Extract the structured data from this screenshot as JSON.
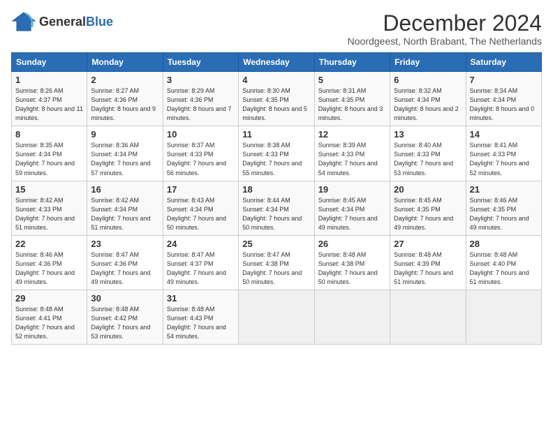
{
  "header": {
    "logo_general": "General",
    "logo_blue": "Blue",
    "title": "December 2024",
    "subtitle": "Noordgeest, North Brabant, The Netherlands"
  },
  "calendar": {
    "days_of_week": [
      "Sunday",
      "Monday",
      "Tuesday",
      "Wednesday",
      "Thursday",
      "Friday",
      "Saturday"
    ],
    "weeks": [
      [
        {
          "day": "1",
          "sunrise": "8:26 AM",
          "sunset": "4:37 PM",
          "daylight": "8 hours and 11 minutes."
        },
        {
          "day": "2",
          "sunrise": "8:27 AM",
          "sunset": "4:36 PM",
          "daylight": "8 hours and 9 minutes."
        },
        {
          "day": "3",
          "sunrise": "8:29 AM",
          "sunset": "4:36 PM",
          "daylight": "8 hours and 7 minutes."
        },
        {
          "day": "4",
          "sunrise": "8:30 AM",
          "sunset": "4:35 PM",
          "daylight": "8 hours and 5 minutes."
        },
        {
          "day": "5",
          "sunrise": "8:31 AM",
          "sunset": "4:35 PM",
          "daylight": "8 hours and 3 minutes."
        },
        {
          "day": "6",
          "sunrise": "8:32 AM",
          "sunset": "4:34 PM",
          "daylight": "8 hours and 2 minutes."
        },
        {
          "day": "7",
          "sunrise": "8:34 AM",
          "sunset": "4:34 PM",
          "daylight": "8 hours and 0 minutes."
        }
      ],
      [
        {
          "day": "8",
          "sunrise": "8:35 AM",
          "sunset": "4:34 PM",
          "daylight": "7 hours and 59 minutes."
        },
        {
          "day": "9",
          "sunrise": "8:36 AM",
          "sunset": "4:34 PM",
          "daylight": "7 hours and 57 minutes."
        },
        {
          "day": "10",
          "sunrise": "8:37 AM",
          "sunset": "4:33 PM",
          "daylight": "7 hours and 56 minutes."
        },
        {
          "day": "11",
          "sunrise": "8:38 AM",
          "sunset": "4:33 PM",
          "daylight": "7 hours and 55 minutes."
        },
        {
          "day": "12",
          "sunrise": "8:39 AM",
          "sunset": "4:33 PM",
          "daylight": "7 hours and 54 minutes."
        },
        {
          "day": "13",
          "sunrise": "8:40 AM",
          "sunset": "4:33 PM",
          "daylight": "7 hours and 53 minutes."
        },
        {
          "day": "14",
          "sunrise": "8:41 AM",
          "sunset": "4:33 PM",
          "daylight": "7 hours and 52 minutes."
        }
      ],
      [
        {
          "day": "15",
          "sunrise": "8:42 AM",
          "sunset": "4:33 PM",
          "daylight": "7 hours and 51 minutes."
        },
        {
          "day": "16",
          "sunrise": "8:42 AM",
          "sunset": "4:34 PM",
          "daylight": "7 hours and 51 minutes."
        },
        {
          "day": "17",
          "sunrise": "8:43 AM",
          "sunset": "4:34 PM",
          "daylight": "7 hours and 50 minutes."
        },
        {
          "day": "18",
          "sunrise": "8:44 AM",
          "sunset": "4:34 PM",
          "daylight": "7 hours and 50 minutes."
        },
        {
          "day": "19",
          "sunrise": "8:45 AM",
          "sunset": "4:34 PM",
          "daylight": "7 hours and 49 minutes."
        },
        {
          "day": "20",
          "sunrise": "8:45 AM",
          "sunset": "4:35 PM",
          "daylight": "7 hours and 49 minutes."
        },
        {
          "day": "21",
          "sunrise": "8:46 AM",
          "sunset": "4:35 PM",
          "daylight": "7 hours and 49 minutes."
        }
      ],
      [
        {
          "day": "22",
          "sunrise": "8:46 AM",
          "sunset": "4:36 PM",
          "daylight": "7 hours and 49 minutes."
        },
        {
          "day": "23",
          "sunrise": "8:47 AM",
          "sunset": "4:36 PM",
          "daylight": "7 hours and 49 minutes."
        },
        {
          "day": "24",
          "sunrise": "8:47 AM",
          "sunset": "4:37 PM",
          "daylight": "7 hours and 49 minutes."
        },
        {
          "day": "25",
          "sunrise": "8:47 AM",
          "sunset": "4:38 PM",
          "daylight": "7 hours and 50 minutes."
        },
        {
          "day": "26",
          "sunrise": "8:48 AM",
          "sunset": "4:38 PM",
          "daylight": "7 hours and 50 minutes."
        },
        {
          "day": "27",
          "sunrise": "8:48 AM",
          "sunset": "4:39 PM",
          "daylight": "7 hours and 51 minutes."
        },
        {
          "day": "28",
          "sunrise": "8:48 AM",
          "sunset": "4:40 PM",
          "daylight": "7 hours and 51 minutes."
        }
      ],
      [
        {
          "day": "29",
          "sunrise": "8:48 AM",
          "sunset": "4:41 PM",
          "daylight": "7 hours and 52 minutes."
        },
        {
          "day": "30",
          "sunrise": "8:48 AM",
          "sunset": "4:42 PM",
          "daylight": "7 hours and 53 minutes."
        },
        {
          "day": "31",
          "sunrise": "8:48 AM",
          "sunset": "4:43 PM",
          "daylight": "7 hours and 54 minutes."
        },
        null,
        null,
        null,
        null
      ]
    ]
  }
}
